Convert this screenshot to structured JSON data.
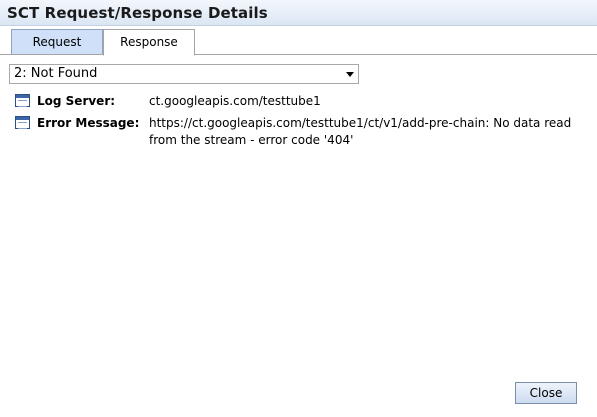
{
  "window": {
    "title": "SCT Request/Response Details"
  },
  "tabs": [
    {
      "label": "Request",
      "selected": false
    },
    {
      "label": "Response",
      "selected": true
    }
  ],
  "response_select": {
    "selected": "2: Not Found"
  },
  "details": {
    "log_server": {
      "icon": "field-icon",
      "label": "Log Server:",
      "value": "ct.googleapis.com/testtube1"
    },
    "error_message": {
      "icon": "field-icon",
      "label": "Error Message:",
      "value": "https://ct.googleapis.com/testtube1/ct/v1/add-pre-chain: No data read from the stream - error code '404'"
    }
  },
  "buttons": {
    "close_label": "Close"
  }
}
